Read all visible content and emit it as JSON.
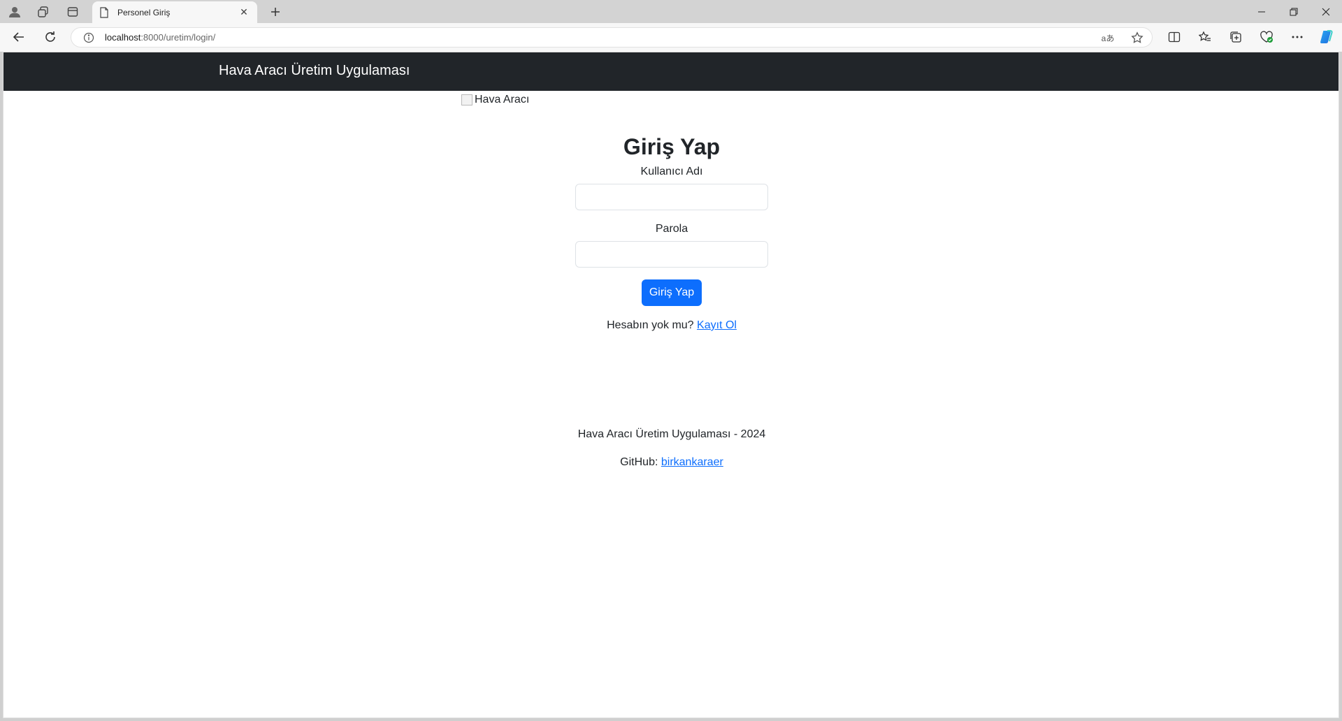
{
  "browser": {
    "tab_title": "Personel Giriş",
    "url_host": "localhost",
    "url_path": ":8000/uretim/login/",
    "read_aloud_glyph": "aあ"
  },
  "page": {
    "brand": "Hava Aracı Üretim Uygulaması",
    "image_alt": "Hava Aracı",
    "login": {
      "title": "Giriş Yap",
      "username_label": "Kullanıcı Adı",
      "username_value": "",
      "password_label": "Parola",
      "password_value": "",
      "submit_label": "Giriş Yap",
      "signup_prompt": "Hesabın yok mu?",
      "signup_link": "Kayıt Ol"
    },
    "footer": {
      "copyright": "Hava Aracı Üretim Uygulaması - 2024",
      "github_label": "GitHub:",
      "github_link": "birkankaraer"
    }
  },
  "colors": {
    "navbar_bg": "#212529",
    "primary": "#0d6efd",
    "text": "#212529"
  }
}
